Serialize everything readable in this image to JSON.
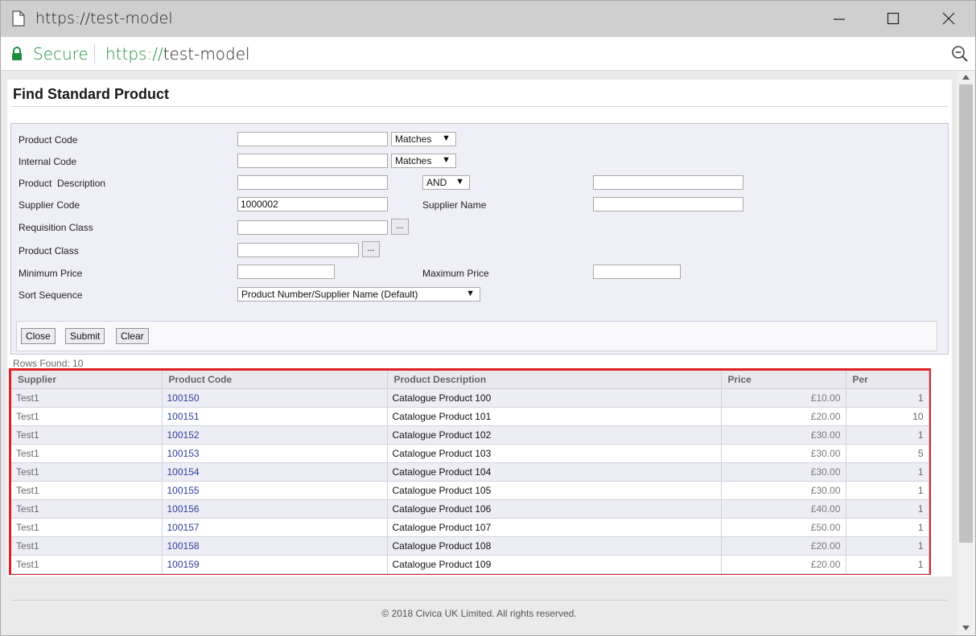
{
  "window": {
    "title": "https://test-model",
    "minimize_icon": "minimize-icon",
    "maximize_icon": "maximize-icon",
    "close_icon": "close-icon"
  },
  "addressbar": {
    "secure_label": "Secure",
    "url_scheme": "https://",
    "url_host": "test-model",
    "secure_color": "#1e8e3e"
  },
  "page": {
    "title": "Find Standard Product"
  },
  "form": {
    "product_code_label": "Product Code",
    "product_code_value": "",
    "product_code_match": "Matches",
    "internal_code_label": "Internal Code",
    "internal_code_value": "",
    "internal_code_match": "Matches",
    "product_description_label": "Product  Description",
    "product_description_value": "",
    "description_operator": "AND",
    "product_description_value2": "",
    "supplier_code_label": "Supplier Code",
    "supplier_code_value": "1000002",
    "supplier_name_label": "Supplier Name",
    "supplier_name_value": "",
    "requisition_class_label": "Requisition Class",
    "requisition_class_value": "",
    "product_class_label": "Product Class",
    "product_class_value": "",
    "minimum_price_label": "Minimum Price",
    "minimum_price_value": "",
    "maximum_price_label": "Maximum Price",
    "maximum_price_value": "",
    "sort_sequence_label": "Sort Sequence",
    "sort_sequence_value": "Product Number/Supplier Name (Default)",
    "lookup_label": "...",
    "arrow": "▼"
  },
  "buttons": {
    "close": "Close",
    "submit": "Submit",
    "clear": "Clear"
  },
  "results": {
    "rows_found": "Rows Found: 10",
    "columns": [
      "Supplier",
      "Product Code",
      "Product Description",
      "Price",
      "Per"
    ],
    "rows": [
      {
        "supplier": "Test1",
        "code": "100150",
        "description": "Catalogue Product 100",
        "price": "£10.00",
        "per": "1"
      },
      {
        "supplier": "Test1",
        "code": "100151",
        "description": "Catalogue Product 101",
        "price": "£20.00",
        "per": "10"
      },
      {
        "supplier": "Test1",
        "code": "100152",
        "description": "Catalogue Product 102",
        "price": "£30.00",
        "per": "1"
      },
      {
        "supplier": "Test1",
        "code": "100153",
        "description": "Catalogue Product 103",
        "price": "£30.00",
        "per": "5"
      },
      {
        "supplier": "Test1",
        "code": "100154",
        "description": "Catalogue Product 104",
        "price": "£30.00",
        "per": "1"
      },
      {
        "supplier": "Test1",
        "code": "100155",
        "description": "Catalogue Product 105",
        "price": "£30.00",
        "per": "1"
      },
      {
        "supplier": "Test1",
        "code": "100156",
        "description": "Catalogue Product 106",
        "price": "£40.00",
        "per": "1"
      },
      {
        "supplier": "Test1",
        "code": "100157",
        "description": "Catalogue Product 107",
        "price": "£50.00",
        "per": "1"
      },
      {
        "supplier": "Test1",
        "code": "100158",
        "description": "Catalogue Product 108",
        "price": "£20.00",
        "per": "1"
      },
      {
        "supplier": "Test1",
        "code": "100159",
        "description": "Catalogue Product 109",
        "price": "£20.00",
        "per": "1"
      }
    ],
    "highlight_color": "#e21f26"
  },
  "footer": {
    "copyright": "© 2018 Civica UK Limited. All rights reserved."
  }
}
